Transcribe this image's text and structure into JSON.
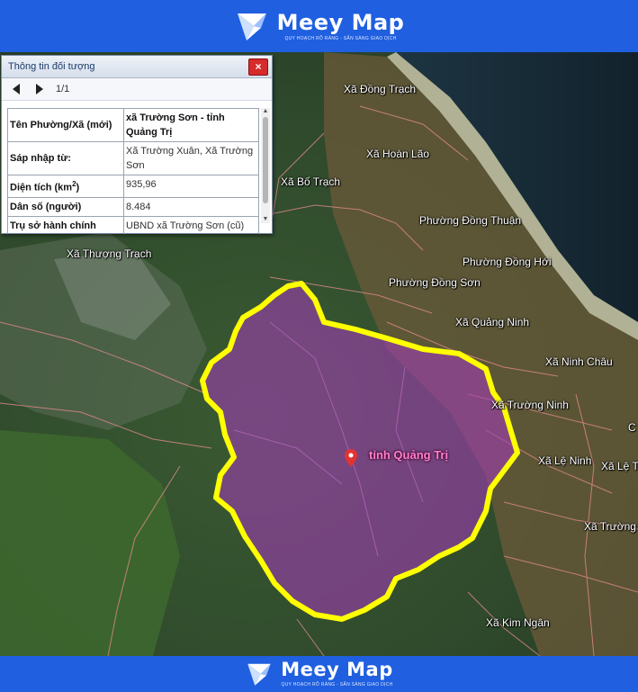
{
  "header": {
    "brand": "Meey Map",
    "slogan": "QUY HOẠCH RÕ RÀNG - SẴN SÀNG GIAO DỊCH"
  },
  "footer": {
    "brand": "Meey Map",
    "slogan": "QUY HOẠCH RÕ RÀNG - SẴN SÀNG GIAO DỊCH"
  },
  "colors": {
    "banner": "#1f5fe0",
    "boundary": "#ffff00",
    "fill": "#a03cb4",
    "label": "#ff7fd0"
  },
  "panel": {
    "title": "Thông tin đối tượng",
    "close": "×",
    "pager": "1/1",
    "rows": [
      {
        "key": "Tên Phường/Xã (mới)",
        "value": "xã Trường Sơn - tỉnh Quảng Trị"
      },
      {
        "key": "Sáp nhập từ:",
        "value": "Xã Trường Xuân, Xã Trường Sơn"
      },
      {
        "key": "Diện tích (km",
        "key_sup": "2",
        "key_end": ")",
        "value": "935,96"
      },
      {
        "key": "Dân số (người)",
        "value": "8.484"
      },
      {
        "key": "Trụ sở hành chính (mới)",
        "value": "UBND xã Trường Sơn (cũ)"
      }
    ]
  },
  "map": {
    "selected_label": "tỉnh Quảng Trị",
    "places": {
      "dong_trach": "Xã Đồng Trạch",
      "hoan_lao": "Xã Hoàn Lão",
      "bo_trach": "Xã Bố Trạch",
      "dong_thuan": "Phường Đồng Thuận",
      "dong_hoi": "Phường Đồng Hới",
      "dong_son": "Phường Đồng Sơn",
      "thuong_trach": "Xã Thượng Trạch",
      "quang_ninh": "Xã Quảng Ninh",
      "ninh_chau": "Xã Ninh Châu",
      "truong_ninh": "Xã Trường Ninh",
      "le_ninh": "Xã Lệ Ninh",
      "le_thuy": "Xã Lệ Th",
      "truong_phu": "Xã Trường P",
      "kim_ngan": "Xã Kim Ngân",
      "edge_c": "C"
    }
  }
}
